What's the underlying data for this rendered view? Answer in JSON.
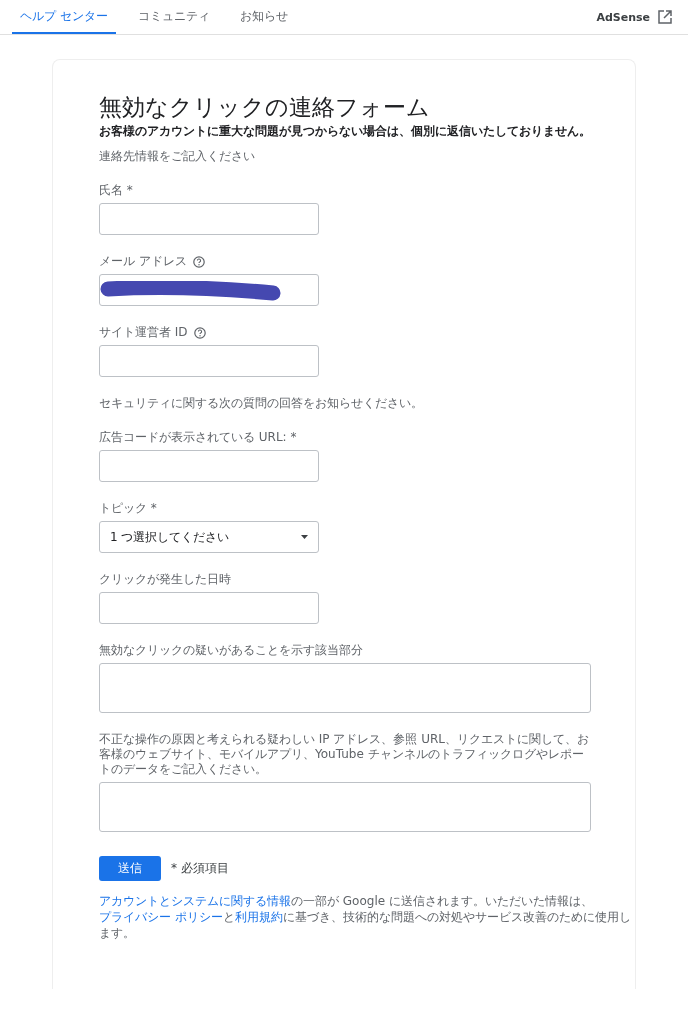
{
  "header": {
    "tabs": [
      {
        "label": "ヘルプ センター",
        "selected": true
      },
      {
        "label": "コミュニティ",
        "selected": false
      },
      {
        "label": "お知らせ",
        "selected": false
      }
    ],
    "product": "AdSense"
  },
  "form": {
    "title": "無効なクリックの連絡フォーム",
    "subtitle": "お客様のアカウントに重大な問題が見つからない場合は、個別に返信いたしておりません。",
    "items": [
      {
        "kind": "note",
        "text": "連絡先情報をご記入ください"
      },
      {
        "kind": "input",
        "label": "氏名 *",
        "help": false
      },
      {
        "kind": "input",
        "label": "メール アドレス",
        "help": true,
        "redacted": true
      },
      {
        "kind": "input",
        "label": "サイト運営者 ID",
        "help": true
      },
      {
        "kind": "note",
        "text": "セキュリティに関する次の質問の回答をお知らせください。"
      },
      {
        "kind": "input",
        "label": "広告コードが表示されている URL: *",
        "help": false
      },
      {
        "kind": "select",
        "label": "トピック *",
        "value": "1 つ選択してください",
        "help": false
      },
      {
        "kind": "input",
        "label": "クリックが発生した日時",
        "help": false
      },
      {
        "kind": "textarea",
        "label": "無効なクリックの疑いがあることを示す該当部分",
        "help": false
      },
      {
        "kind": "textarea",
        "label": "不正な操作の原因と考えられる疑わしい IP アドレス、参照 URL、リクエストに関して、お客様のウェブサイト、モバイルアプリ、YouTube チャンネルのトラフィックログやレポートのデータをご記入ください。",
        "help": false
      }
    ],
    "submit": "送信",
    "required_note": "* 必須項目",
    "footer": [
      {
        "kind": "link",
        "text": "アカウントとシステムに関する情報"
      },
      {
        "kind": "text",
        "text": "の一部が Google に送信されます。いただいた情報は、"
      },
      {
        "kind": "link",
        "text": "プライバシー ポリシー"
      },
      {
        "kind": "text",
        "text": "と"
      },
      {
        "kind": "link",
        "text": "利用規約"
      },
      {
        "kind": "text",
        "text": "に基づき、技術的な問題への対処やサービス改善のために使用します。"
      }
    ]
  }
}
